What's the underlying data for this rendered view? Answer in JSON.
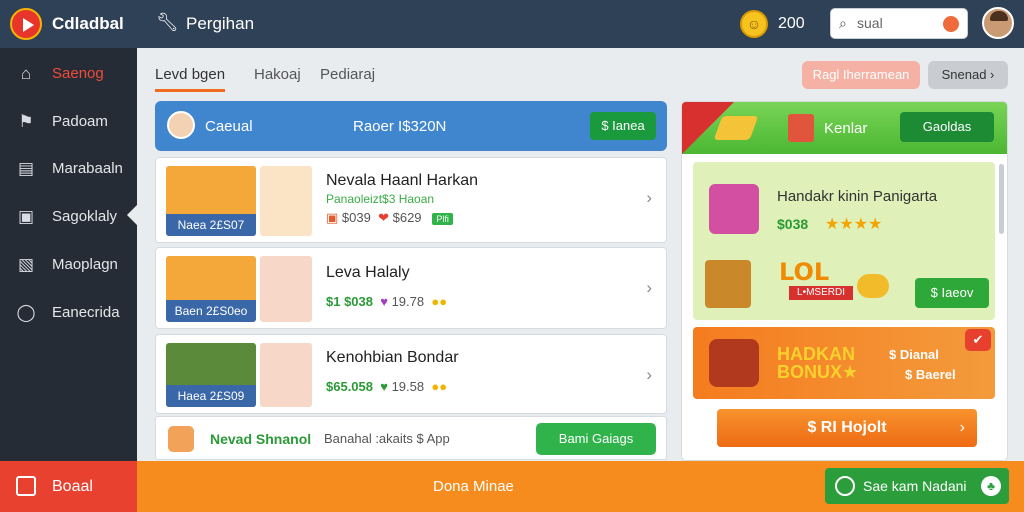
{
  "header": {
    "app_title": "Cdladbal",
    "nav_title": "Pergihan",
    "coins": "200",
    "search_value": "sual"
  },
  "sidebar": {
    "items": [
      {
        "label": "Saenog",
        "icon": "home-icon"
      },
      {
        "label": "Padoam",
        "icon": "flag-icon"
      },
      {
        "label": "Marabaaln",
        "icon": "cart-icon"
      },
      {
        "label": "Sagoklaly",
        "icon": "book-icon"
      },
      {
        "label": "Maoplagn",
        "icon": "users-icon"
      },
      {
        "label": "Eanecrida",
        "icon": "chat-icon"
      }
    ],
    "bottom_label": "Boaal"
  },
  "tabs": [
    "Levd bgen",
    "Hakoaj",
    "Pediaraj"
  ],
  "toolbar": {
    "red_button": "Ragl Iherramean",
    "grey_button": "Snenad ›"
  },
  "list_header": {
    "left": "Caeual",
    "center": "Raoer I$320N",
    "button": "$ Ianea"
  },
  "rows": [
    {
      "caption": "Naea 2£S07",
      "title": "Nevala Haanl Harkan",
      "sub": "Panaoleizt$3 Haoan",
      "price1": "$039",
      "price2": "$629",
      "tag": "Plfi"
    },
    {
      "caption": "Baen 2£S0eo",
      "title": "Leva Halaly",
      "price1": "$1 $038",
      "price2": "19.78"
    },
    {
      "caption": "Haea 2£S09",
      "title": "Kenohbian Bondar",
      "price1": "$65.058",
      "price2": "19.58"
    }
  ],
  "invite": {
    "title": "Nevad Shnanol",
    "text": "Banahal :akaits $ App",
    "button": "Bami Gaiags"
  },
  "right_panel": {
    "header_label": "Kenlar",
    "header_button": "Gaoldas",
    "promo1_title": "Handakr kinin Panigarta",
    "promo1_price": "$038",
    "promo1_stars": "★★★★",
    "lol": "LOL",
    "lol_sub": "L•MSERDI",
    "promo1_button": "$ Iaeov",
    "promo2_big1": "HADKAN",
    "promo2_big2": "BONUX★",
    "promo2_r1": "$ Dianal",
    "promo2_r2": "$ Baerel",
    "promo2_badge": "✔",
    "cta": "$ RI Hojolt",
    "cta_chevron": "›"
  },
  "bottom": {
    "center": "Dona Minae",
    "button": "Sae kam Nadani"
  },
  "colors": {
    "accent_orange": "#f78c1e",
    "brand_red": "#e9412f",
    "header_blue": "#3f86cf",
    "success_green": "#2fb34a"
  }
}
